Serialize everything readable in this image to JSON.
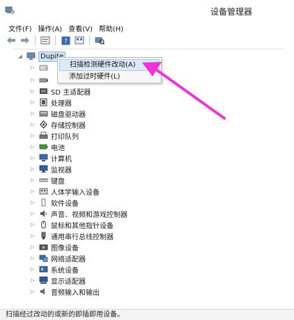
{
  "window": {
    "title": "设备管理器",
    "app_icon": "device-manager-icon"
  },
  "menu": [
    {
      "label": "文件(F)"
    },
    {
      "label": "操作(A)"
    },
    {
      "label": "查看(V)"
    },
    {
      "label": "帮助(H)"
    }
  ],
  "toolbar": [
    {
      "icon": "back-arrow-icon"
    },
    {
      "icon": "forward-arrow-icon"
    },
    {
      "icon": "properties-icon"
    },
    {
      "icon": "help-icon"
    },
    {
      "icon": "view-icon"
    },
    {
      "icon": "scan-hardware-icon"
    }
  ],
  "tree": {
    "root": {
      "label": "Dupite",
      "icon": "computer-icon"
    },
    "categories": [
      {
        "label": "",
        "icon": "drive-icon"
      },
      {
        "label": "",
        "icon": "controller-icon"
      },
      {
        "label": "SD 主适配器",
        "icon": "sd-adapter-icon"
      },
      {
        "label": "处理器",
        "icon": "processor-icon"
      },
      {
        "label": "磁盘驱动器",
        "icon": "disk-drive-icon"
      },
      {
        "label": "存储控制器",
        "icon": "storage-controller-icon"
      },
      {
        "label": "打印队列",
        "icon": "print-queue-icon"
      },
      {
        "label": "电池",
        "icon": "battery-icon"
      },
      {
        "label": "计算机",
        "icon": "computer-icon"
      },
      {
        "label": "监视器",
        "icon": "monitor-icon"
      },
      {
        "label": "键盘",
        "icon": "keyboard-icon"
      },
      {
        "label": "人体学输入设备",
        "icon": "hid-icon"
      },
      {
        "label": "软件设备",
        "icon": "software-device-icon"
      },
      {
        "label": "声音、视频和游戏控制器",
        "icon": "sound-icon"
      },
      {
        "label": "鼠标和其他指针设备",
        "icon": "mouse-icon"
      },
      {
        "label": "通用串行总线控制器",
        "icon": "usb-icon"
      },
      {
        "label": "图像设备",
        "icon": "camera-icon"
      },
      {
        "label": "网络适配器",
        "icon": "network-icon"
      },
      {
        "label": "系统设备",
        "icon": "system-device-icon"
      },
      {
        "label": "显示适配器",
        "icon": "display-adapter-icon"
      },
      {
        "label": "音频输入和输出",
        "icon": "audio-io-icon"
      }
    ]
  },
  "context_menu": {
    "items": [
      {
        "label": "扫描检测硬件改动(A)",
        "highlighted": true
      },
      {
        "label": "添加过时硬件(L)",
        "highlighted": false
      }
    ]
  },
  "annotation": {
    "arrow_color": "#ee33dd"
  },
  "status": {
    "text": "扫描经过改动的或新的即插即用设备。"
  }
}
